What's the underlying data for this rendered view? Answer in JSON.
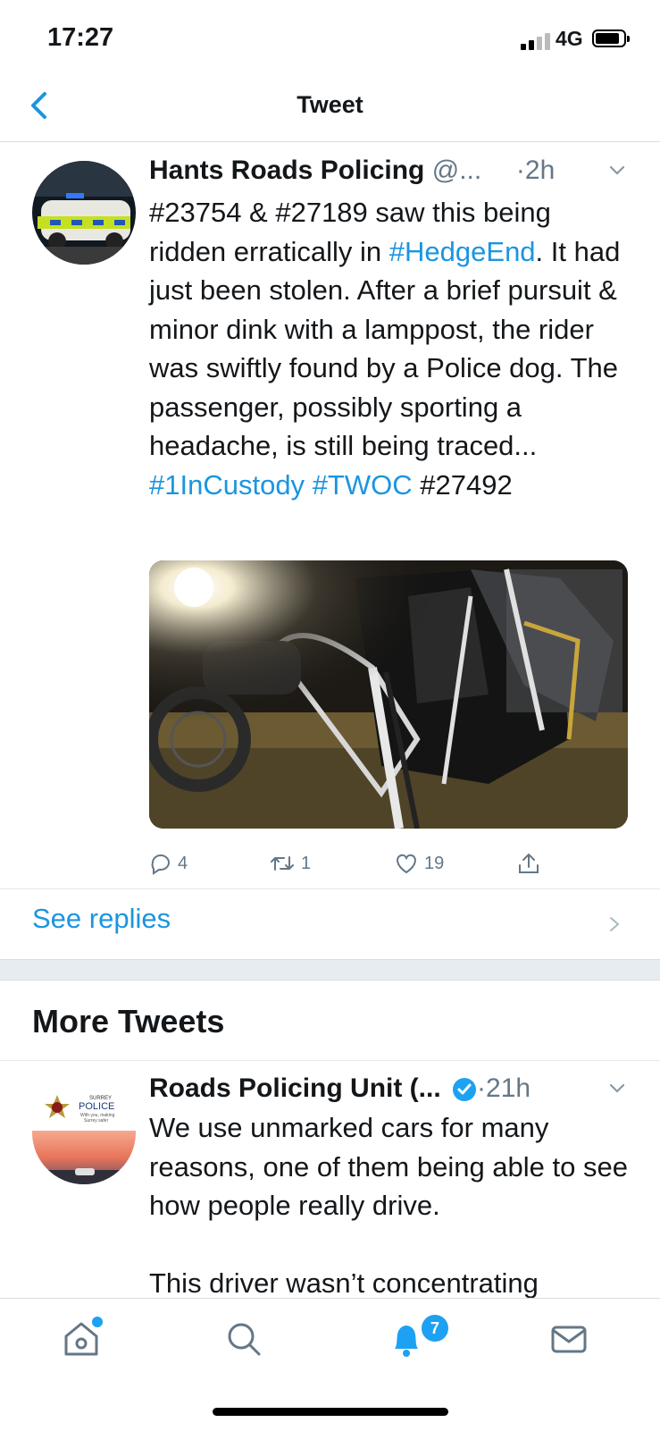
{
  "status_bar": {
    "time": "17:27",
    "network": "4G"
  },
  "nav": {
    "title": "Tweet"
  },
  "tweet": {
    "author_name": "Hants Roads Policing",
    "author_handle": "@...",
    "separator": "·",
    "time_ago": "2h",
    "text_segments": [
      {
        "text": "#23754 & #27189 saw this being ridden erratically in ",
        "type": "plain"
      },
      {
        "text": "#HedgeEnd",
        "type": "hashtag"
      },
      {
        "text": ". It had just been stolen. After a brief pursuit & minor dink with a lamppost, the rider was swiftly found by a Police dog. The passenger, possibly sporting a headache, is still being traced... ",
        "type": "plain"
      },
      {
        "text": "#1InCustody",
        "type": "hashtag"
      },
      {
        "text": " ",
        "type": "plain"
      },
      {
        "text": "#TWOC",
        "type": "hashtag"
      },
      {
        "text": " #27492",
        "type": "plain"
      }
    ],
    "reply_count": "4",
    "retweet_count": "1",
    "like_count": "19"
  },
  "see_replies": {
    "label": "See replies"
  },
  "more_tweets": {
    "title": "More Tweets"
  },
  "tweet2": {
    "author_name": "Roads Policing Unit (...",
    "separator": "·",
    "time_ago": "21h",
    "text_line1": "We use unmarked cars for many reasons, one of them being able to see how people really drive.",
    "text_line2": "This driver wasn’t concentrating",
    "avatar_text": {
      "line1": "SURREY",
      "line2": "POLICE",
      "line3": "With you, making",
      "line4": "Surrey safer"
    }
  },
  "tab_bar": {
    "notifications_badge": "7"
  },
  "colors": {
    "accent": "#1b95e0",
    "secondary_text": "#657786",
    "divider": "#e1e8ed"
  },
  "icons": [
    "chevron-left-icon",
    "chevron-down-icon",
    "reply-icon",
    "retweet-icon",
    "like-icon",
    "share-icon",
    "chevron-right-icon",
    "verified-icon",
    "home-icon",
    "search-icon",
    "bell-icon",
    "mail-icon"
  ]
}
